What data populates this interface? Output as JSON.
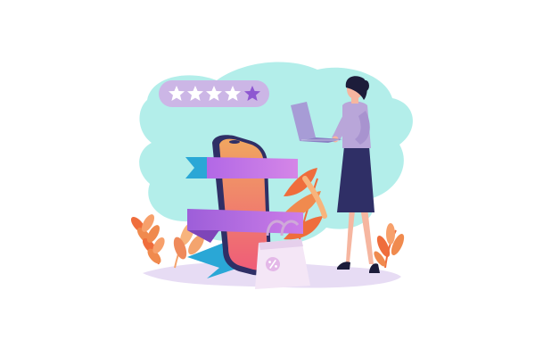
{
  "illustration": {
    "subject": "online-shopping-review",
    "rating": {
      "value": 4,
      "max": 5
    },
    "icons": {
      "stars": "star-icon",
      "discount_tag": "percent-icon"
    },
    "palette": {
      "background": "#ffffff",
      "cloud": "#a6ebe6",
      "rating_pill": "#ccb6e6",
      "star_filled": "#ffffff",
      "star_highlight": "#8e57d1",
      "phone_gradient_top": "#f0a660",
      "phone_gradient_bottom": "#ef5d78",
      "ribbon_purple": "#b268e6",
      "ribbon_blue": "#2aa7d6",
      "leaves_orange": "#ef6d3c",
      "leaves_peach": "#f7b47c",
      "bag": "#f4e6f6",
      "woman_top": "#b9a6d9",
      "woman_skirt": "#2f2f66",
      "skin": "#f6b6a0",
      "hair": "#1c1c3a",
      "laptop": "#a79cd6",
      "ground": "#d7c8ee"
    }
  }
}
